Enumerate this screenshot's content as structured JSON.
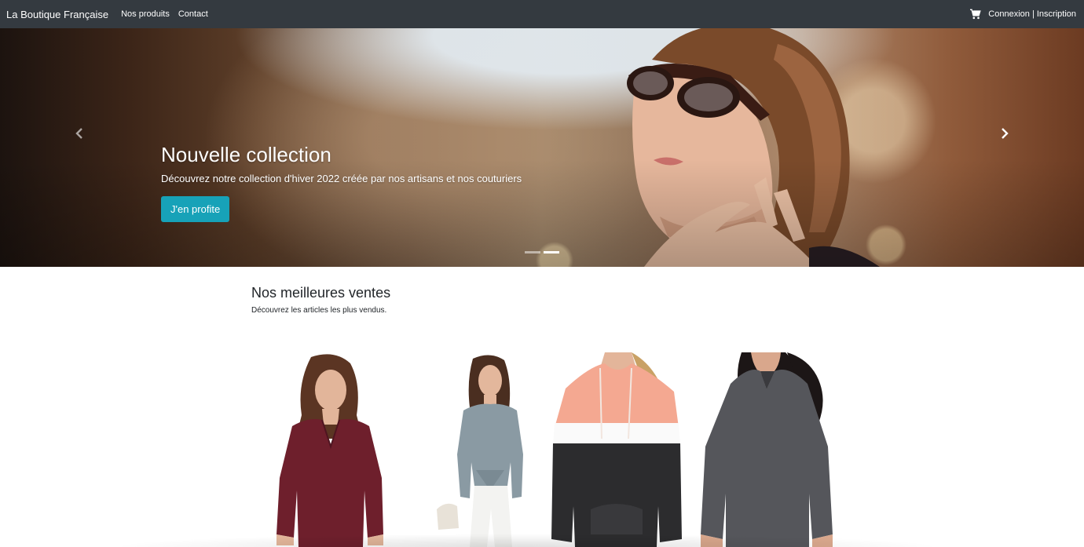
{
  "navbar": {
    "brand": "La Boutique Française",
    "links": [
      "Nos produits",
      "Contact"
    ],
    "cart_icon": "cart-icon",
    "account_link": "Connexion | Inscription"
  },
  "carousel": {
    "title": "Nouvelle collection",
    "text": "Découvrez notre collection d'hiver 2022 créée par nos artisans et nos couturiers",
    "button": "J'en profite",
    "prev_icon": "chevron-left-icon",
    "next_icon": "chevron-right-icon",
    "slides": 2,
    "active_slide": 2
  },
  "bestsellers": {
    "title": "Nos meilleures ventes",
    "subtitle": "Découvrez les articles les plus vendus.",
    "products": [
      {
        "image": "burgundy-blouse-photo"
      },
      {
        "image": "grey-satin-shirt-photo"
      },
      {
        "image": "pink-white-black-hoodie-photo"
      },
      {
        "image": "grey-hoodie-photo"
      }
    ]
  },
  "colors": {
    "navbar": "#343a40",
    "accent_button": "#17a2b8",
    "text": "#212529"
  }
}
